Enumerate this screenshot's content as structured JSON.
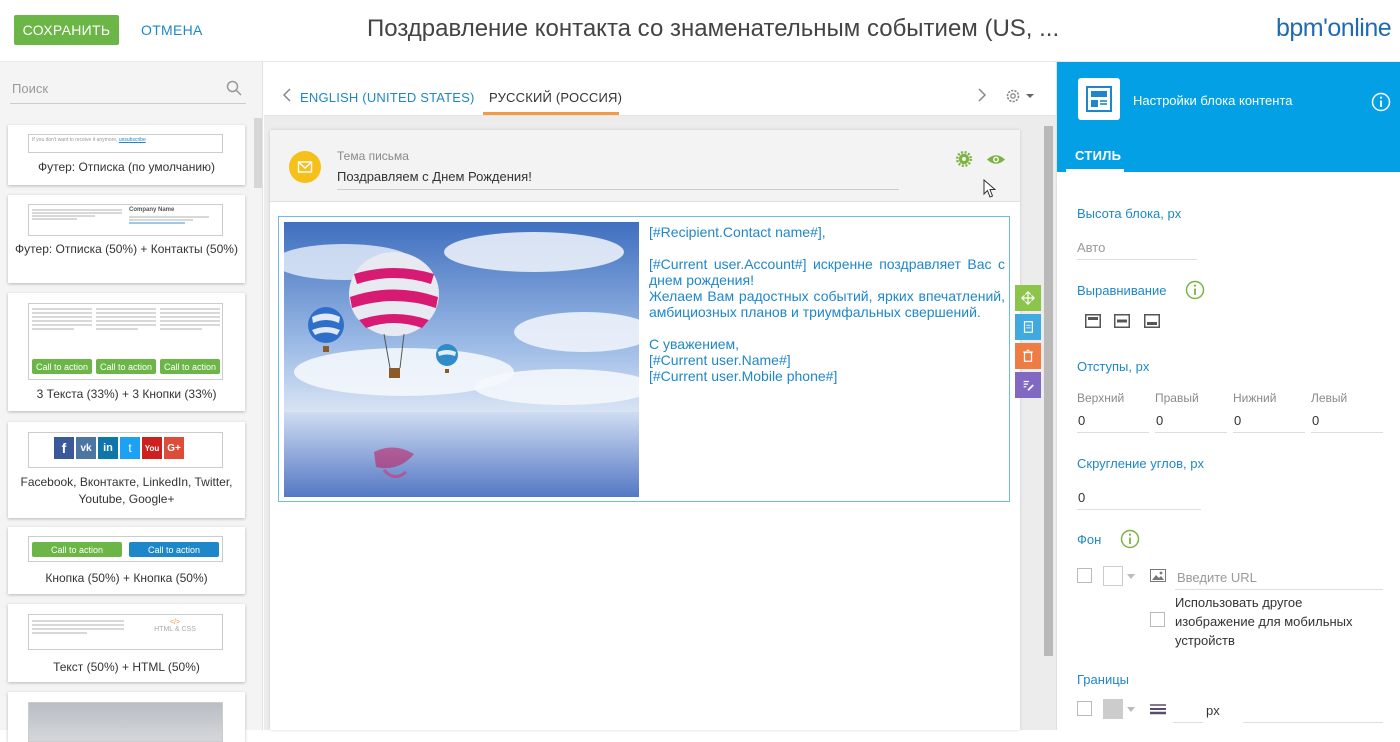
{
  "header": {
    "save_label": "СОХРАНИТЬ",
    "cancel_label": "ОТМЕНА",
    "title": "Поздравление контакта со знаменательным событием (US, ...",
    "logo": "bpm'online"
  },
  "sidebar": {
    "search_placeholder": "Поиск",
    "tiles": [
      {
        "label": "Футер: Отписка (по умолчанию)"
      },
      {
        "label": "Футер: Отписка (50%) + Контакты (50%)"
      },
      {
        "label": "3 Текста (33%) + 3 Кнопки (33%)"
      },
      {
        "label": "Facebook, Вконтакте, LinkedIn, Twitter, Youtube, Google+"
      },
      {
        "label": "Кнопка (50%) + Кнопка (50%)"
      },
      {
        "label": "Текст (50%) + HTML (50%)"
      }
    ],
    "thumbs": {
      "unsubscribe_text": "If you don't want to receive it anymore,",
      "unsubscribe_link": "unsubscribe",
      "contacts_company": "Company Name",
      "cta_label": "Call to action",
      "html_css": "HTML & CSS"
    }
  },
  "editor": {
    "tabs": [
      {
        "label": "ENGLISH (UNITED STATES)"
      },
      {
        "label": "РУССКИЙ (РОССИЯ)"
      }
    ],
    "subject_label": "Тема письма",
    "subject_value": "Поздравляем с Днем Рождения!",
    "message": {
      "line1": "[#Recipient.Contact name#],",
      "line2": "[#Current user.Account#] искренне поздравляет Вас с днем рождения!",
      "line3": "Желаем Вам радостных событий, ярких впечатлений, амбициозных планов и триумфальных свершений.",
      "line4": "С уважением,",
      "line5": "[#Current user.Name#]",
      "line6": "[#Current user.Mobile phone#]"
    }
  },
  "settings": {
    "header_title": "Настройки блока контента",
    "tab_style": "СТИЛЬ",
    "block_height_label": "Высота блока, px",
    "block_height_placeholder": "Авто",
    "alignment_label": "Выравнивание",
    "padding_label": "Отступы, px",
    "padding": {
      "top_label": "Верхний",
      "top_value": "0",
      "right_label": "Правый",
      "right_value": "0",
      "bottom_label": "Нижний",
      "bottom_value": "0",
      "left_label": "Левый",
      "left_value": "0"
    },
    "radius_label": "Скругление углов, px",
    "radius_value": "0",
    "background_label": "Фон",
    "url_placeholder": "Введите URL",
    "mobile_image_label": "Использовать другое изображение для мобильных устройств",
    "borders_label": "Границы",
    "px_unit": "px"
  },
  "colors": {
    "accent_green": "#6cb547",
    "link_blue": "#1e87c9",
    "panel_blue": "#03a0e6",
    "tab_orange": "#f19c45"
  }
}
